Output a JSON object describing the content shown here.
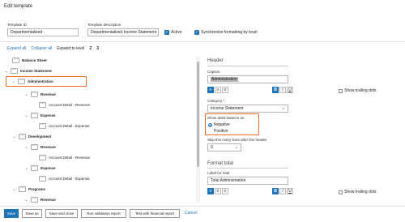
{
  "window": {
    "title": "Edit template"
  },
  "form": {
    "template_id_label": "Template ID",
    "template_id_value": "Departmentalized",
    "template_desc_label": "Template description",
    "template_desc_value": "Departmentalized Income Statement",
    "active_label": "Active",
    "sync_label": "Synchronize formatting by level"
  },
  "tree_controls": {
    "expand_all": "Expand all",
    "collapse_all": "Collapse all",
    "expand_to_level": "Expand to level",
    "levels": [
      "2",
      "3"
    ]
  },
  "tree": [
    {
      "label": "Balance Sheet",
      "bold": true
    },
    {
      "label": "Income Statement",
      "bold": true
    },
    {
      "label": "Administration",
      "bold": true
    },
    {
      "label": "Revenue",
      "bold": true
    },
    {
      "label": "Account Detail - Revenue",
      "bold": false
    },
    {
      "label": "Expense",
      "bold": true
    },
    {
      "label": "Account Detail - Expense",
      "bold": false
    },
    {
      "label": "Development",
      "bold": true
    },
    {
      "label": "Revenue",
      "bold": true
    },
    {
      "label": "Account Detail - Revenue",
      "bold": false
    },
    {
      "label": "Expense",
      "bold": true
    },
    {
      "label": "Account Detail - Expense",
      "bold": false
    },
    {
      "label": "Programs",
      "bold": true
    },
    {
      "label": "Revenue",
      "bold": true
    }
  ],
  "header_panel": {
    "section_title": "Header",
    "caption_label": "Caption",
    "caption_value": "Administration",
    "show_trailing_dots": "Show trailing dots",
    "category_label": "Category",
    "category_required": "*",
    "category_value": "Income Statement",
    "debit_balance_label": "Show debit balance as",
    "debit_options": [
      "Negative",
      "Positive"
    ],
    "skip_lines_label": "Skip this many lines after this header",
    "skip_lines_value": "0"
  },
  "format_total": {
    "section_title": "Format total",
    "label_for_total": "Label for total",
    "label_for_total_value": "Total Administration",
    "show_trailing_dots": "Show trailing dots"
  },
  "toolbar_glyphs": {
    "align_left": "≡",
    "align_center": "≡",
    "align_right": "≡",
    "bold": "B",
    "italic": "I",
    "underline": "U"
  },
  "footer": {
    "save": "Save",
    "save_as": "Save as",
    "save_close": "Save and close",
    "run_validation": "Run validation report",
    "test_financial": "Test with financial report",
    "cancel": "Cancel"
  },
  "colors": {
    "accent": "#1f73b7",
    "highlight": "#ee6a22"
  }
}
